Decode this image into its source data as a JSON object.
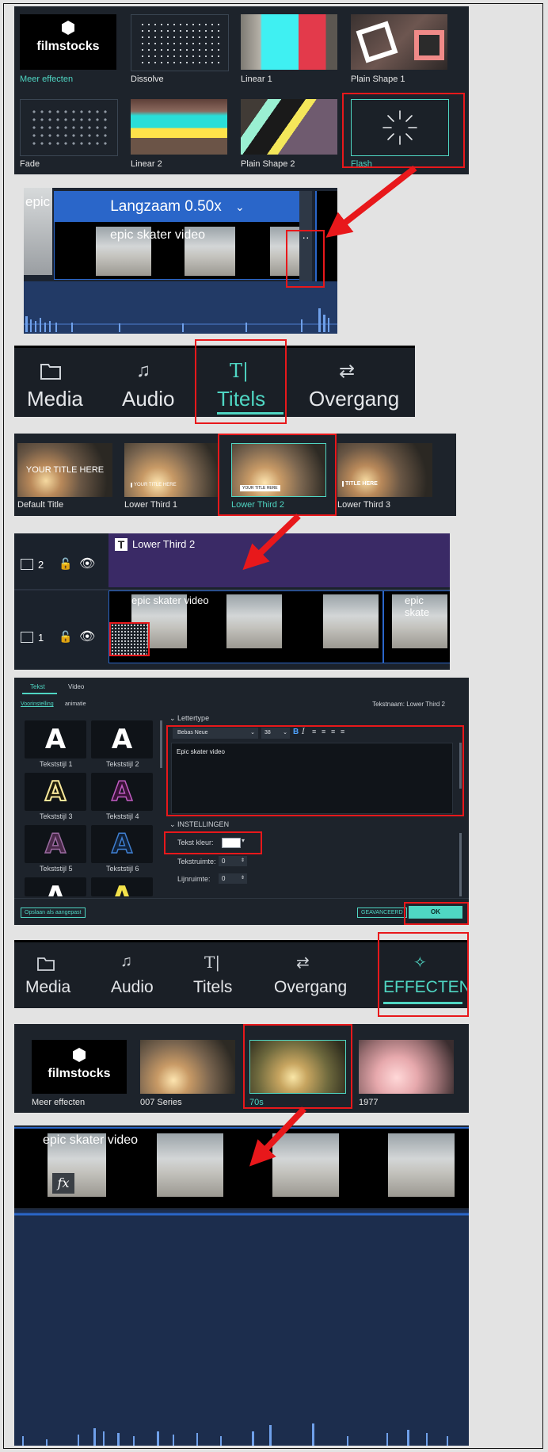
{
  "panel1": {
    "items": [
      {
        "label": "Meer effecten",
        "selected": false
      },
      {
        "label": "Dissolve",
        "selected": false
      },
      {
        "label": "Linear 1",
        "selected": false
      },
      {
        "label": "Plain Shape 1",
        "selected": false
      },
      {
        "label": "Fade",
        "selected": false
      },
      {
        "label": "Linear 2",
        "selected": false
      },
      {
        "label": "Plain Shape 2",
        "selected": false
      },
      {
        "label": "Flash",
        "selected": true
      }
    ],
    "logo_text": "filmstocks"
  },
  "timeline1": {
    "speed_label": "Langzaam 0.50x",
    "clip_title": "epic skater video",
    "left_clip_text": "epic",
    "transition_marker": "··"
  },
  "nav1": {
    "items": [
      {
        "label": "Media",
        "icon": "folder-icon"
      },
      {
        "label": "Audio",
        "icon": "music-note-icon"
      },
      {
        "label": "Titels",
        "icon": "text-cursor-icon",
        "active": true
      },
      {
        "label": "Overgang",
        "icon": "transition-icon"
      }
    ]
  },
  "titles_panel": {
    "items": [
      {
        "label": "Default Title",
        "overlay": "YOUR TITLE HERE"
      },
      {
        "label": "Lower Third 1",
        "overlay": "YOUR TITLE HERE"
      },
      {
        "label": "Lower Third 2",
        "overlay": "YOUR TITLE HERE",
        "selected": true
      },
      {
        "label": "Lower Third 3",
        "overlay": "TITLE HERE"
      }
    ]
  },
  "timeline2": {
    "track2_number": "2",
    "track1_number": "1",
    "title_clip_label": "Lower Third 2",
    "title_clip_icon": "T",
    "video_clip_title": "epic skater video",
    "video_clip_title_right": "epic skate"
  },
  "editor": {
    "tabs": [
      "Tekst",
      "Video"
    ],
    "subtabs": [
      "Voorinstelling",
      "animatie"
    ],
    "text_name": "Tekstnaam: Lower Third 2",
    "section_font": "Lettertype",
    "font_name": "Bebas Neue",
    "font_size": "38",
    "text_value": "Epic skater video",
    "section_settings": "INSTELLINGEN",
    "text_color_label": "Tekst kleur:",
    "text_spacing_label": "Tekstruimte:",
    "text_spacing_value": "0",
    "line_spacing_label": "Lijnruimte:",
    "line_spacing_value": "0",
    "styles": [
      {
        "label": "Tekststijl 1",
        "glyph": "A",
        "color": "#ffffff"
      },
      {
        "label": "Tekststijl 2",
        "glyph": "A",
        "color": "#ffffff"
      },
      {
        "label": "Tekststijl 3",
        "glyph": "A",
        "color": "#fff7d0"
      },
      {
        "label": "Tekststijl 4",
        "glyph": "A",
        "color": "#3a1238"
      },
      {
        "label": "Tekststijl 5",
        "glyph": "A",
        "color": "#4a2a4a"
      },
      {
        "label": "Tekststijl 6",
        "glyph": "A",
        "color": "#10223a"
      },
      {
        "glyph": "A",
        "color": "#ffffff"
      },
      {
        "glyph": "A",
        "color": "#f2e14a"
      }
    ],
    "save_custom": "Opslaan als aangepast",
    "advanced": "GEAVANCEERD",
    "ok": "OK"
  },
  "nav2": {
    "items": [
      {
        "label": "Media",
        "icon": "folder-icon"
      },
      {
        "label": "Audio",
        "icon": "music-note-icon"
      },
      {
        "label": "Titels",
        "icon": "text-cursor-icon"
      },
      {
        "label": "Overgang",
        "icon": "transition-icon"
      },
      {
        "label": "EFFECTEN",
        "icon": "effects-star-icon",
        "active": true
      }
    ]
  },
  "effects_panel": {
    "logo_text": "filmstocks",
    "items": [
      {
        "label": "Meer effecten"
      },
      {
        "label": "007 Series"
      },
      {
        "label": "70s",
        "selected": true
      },
      {
        "label": "1977"
      }
    ]
  },
  "timeline3": {
    "clip_title": "epic skater video",
    "fx_badge": "fx"
  },
  "colors": {
    "accent": "#4fd6c3",
    "highlight": "#e8181b",
    "panel_bg": "#1d232b",
    "timeline_blue": "#2a66c9",
    "title_track": "#3a2a66"
  }
}
